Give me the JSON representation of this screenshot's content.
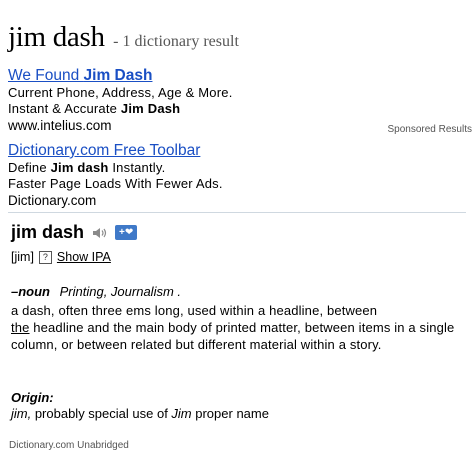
{
  "header": {
    "query": "jim dash",
    "result_summary": "- 1 dictionary result"
  },
  "ads": [
    {
      "title_prefix": "We Found ",
      "title_bold": "Jim Dash",
      "line1": "Current Phone, Address, Age & More.",
      "line2_prefix": "Instant & Accurate ",
      "line2_bold": "Jim Dash",
      "url": "www.intelius.com"
    },
    {
      "title_prefix": "Dictionary.com Free Toolbar",
      "title_bold": "",
      "line1_prefix": "Define ",
      "line1_bold": "Jim dash",
      "line1_suffix": " Instantly.",
      "line2": "Faster Page Loads With Fewer Ads.",
      "url": "Dictionary.com"
    }
  ],
  "sponsored_label": "Sponsored Results",
  "entry": {
    "headword": "jim dash",
    "fav_label": "+❤",
    "pronunciation": "[jim]",
    "help_label": "?",
    "show_ipa": "Show IPA",
    "pos": "–noun",
    "subject": "Printing, Journalism .",
    "definition_1": "a dash, often three ems long, used within a headline, between",
    "definition_link": "the",
    "definition_2": " headline and the main body of printed matter, between items in a single column, or between related but different material within a story.",
    "origin_heading": "Origin:",
    "origin_word": "jim,",
    "origin_text_1": " probably special use of ",
    "origin_word_2": "Jim",
    "origin_text_2": " proper name"
  },
  "source": "Dictionary.com Unabridged",
  "colors": {
    "link": "#1a4fc4",
    "fav_badge": "#3f79c8",
    "divider": "#cfd8e0"
  },
  "icons": {
    "audio": "speaker-icon",
    "help": "help-icon"
  }
}
